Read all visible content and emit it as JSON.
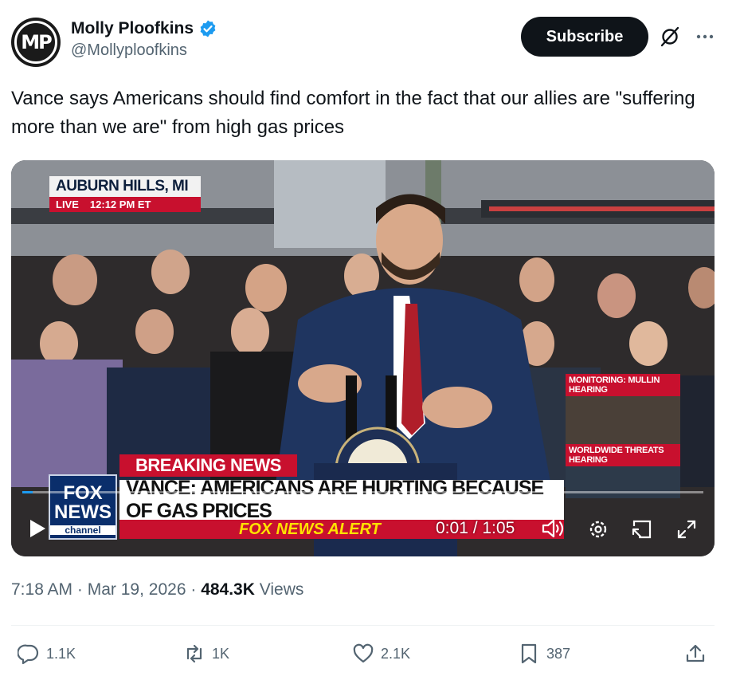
{
  "author": {
    "avatar_initials": "MP",
    "display_name": "Molly Ploofkins",
    "handle": "@Mollyploofkins",
    "verified": true
  },
  "header": {
    "subscribe_label": "Subscribe",
    "icons": [
      "grok-icon",
      "more-icon"
    ]
  },
  "tweet": {
    "text": "Vance says Americans should find comfort in the fact that our allies are \"suffering more than we are\" from high gas prices"
  },
  "video": {
    "locator_city": "AUBURN HILLS, MI",
    "locator_live": "LIVE",
    "locator_time": "12:12 PM ET",
    "breaking_label": "BREAKING NEWS",
    "headline": "VANCE: AMERICANS ARE HURTING BECAUSE OF GAS PRICES",
    "alert_label": "FOX NEWS ALERT",
    "logo_line1": "FOX",
    "logo_line2": "NEWS",
    "logo_line3": "channel",
    "monitor_label_1": "MONITORING: MULLIN HEARING",
    "monitor_label_2": "WORLDWIDE THREATS HEARING",
    "time_display": "0:01 / 1:05",
    "progress_fraction": 0.015
  },
  "meta": {
    "time": "7:18 AM",
    "separator": "·",
    "date": "Mar 19, 2026",
    "views_count": "484.3K",
    "views_label": "Views"
  },
  "actions": {
    "replies": "1.1K",
    "reposts": "1K",
    "likes": "2.1K",
    "bookmarks": "387"
  },
  "colors": {
    "accent": "#1d9bf0",
    "text_primary": "#0f1419",
    "text_secondary": "#536471",
    "fox_red": "#c8102e"
  }
}
